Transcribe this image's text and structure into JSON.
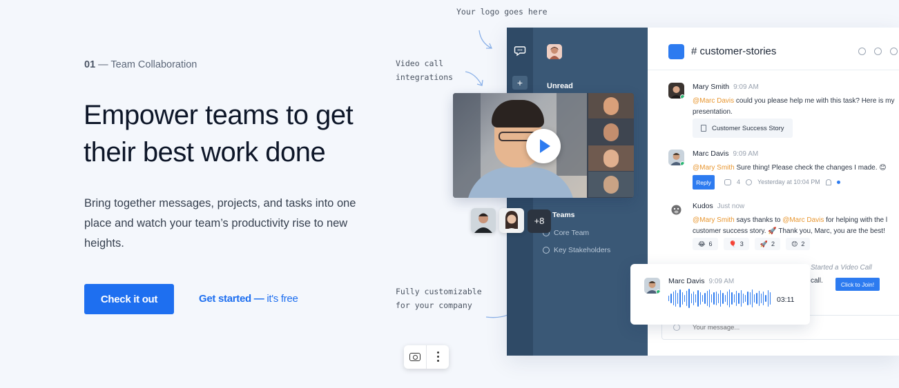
{
  "hero": {
    "eyebrow_num": "01",
    "eyebrow_text": " — Team Collaboration",
    "headline": "Empower teams to get their best work done",
    "lede": "Bring together messages, projects, and tasks into one place and watch your team’s productivity rise to new heights.",
    "cta_primary": "Check it out",
    "cta_link": "Get started —",
    "cta_link_suffix": " it's free"
  },
  "annotations": {
    "logo": "Your logo goes here",
    "video": "Video call\nintegrations",
    "custom": "Fully customizable\nfor your company"
  },
  "app": {
    "sidebar": {
      "rail_plus": "+",
      "unread_label": "Unread",
      "teams_label": "Teams",
      "teams": [
        "Core Team",
        "Key Stakeholders"
      ]
    },
    "channel": "# customer-stories",
    "messages": [
      {
        "name": "Mary Smith",
        "time": "9:09 AM",
        "mention": "@Marc Davis",
        "text": " could you please help me with this task? Here is my presentation.",
        "attachment": "Customer Success Story"
      },
      {
        "name": "Marc Davis",
        "time": "9:09 AM",
        "mention": "@Mary Smith",
        "text": " Sure thing! Please check the changes I made. 😊",
        "reply_label": "Reply",
        "reply_count": "4",
        "reply_time": "Yesterday at 10:04 PM"
      },
      {
        "name": "Kudos",
        "time": "Just now",
        "mention1": "@Mary Smith",
        "text1": " says thanks to ",
        "mention2": "@Marc Davis",
        "text2": " for helping with the l customer success story. 🚀 Thank you, Marc, you are the best!",
        "reactions": [
          {
            "emoji": "😂",
            "count": "6"
          },
          {
            "emoji": "🎈",
            "count": "3"
          },
          {
            "emoji": "🚀",
            "count": "2"
          },
          {
            "emoji": "😊",
            "count": "2"
          }
        ]
      }
    ],
    "video_call": {
      "status": "Started a Video Call",
      "text": "call.",
      "join_label": "Click to Join!"
    },
    "composer_placeholder": "Your message..."
  },
  "video_card": {
    "more_count": "+8"
  },
  "audio_card": {
    "name": "Marc Davis",
    "time": "9:09 AM",
    "duration": "03:11"
  },
  "colors": {
    "accent": "#1e6ff0",
    "sidebar": "#3a5876",
    "rail": "#2f4a66",
    "mention": "#e8962f",
    "online": "#2bb673"
  }
}
